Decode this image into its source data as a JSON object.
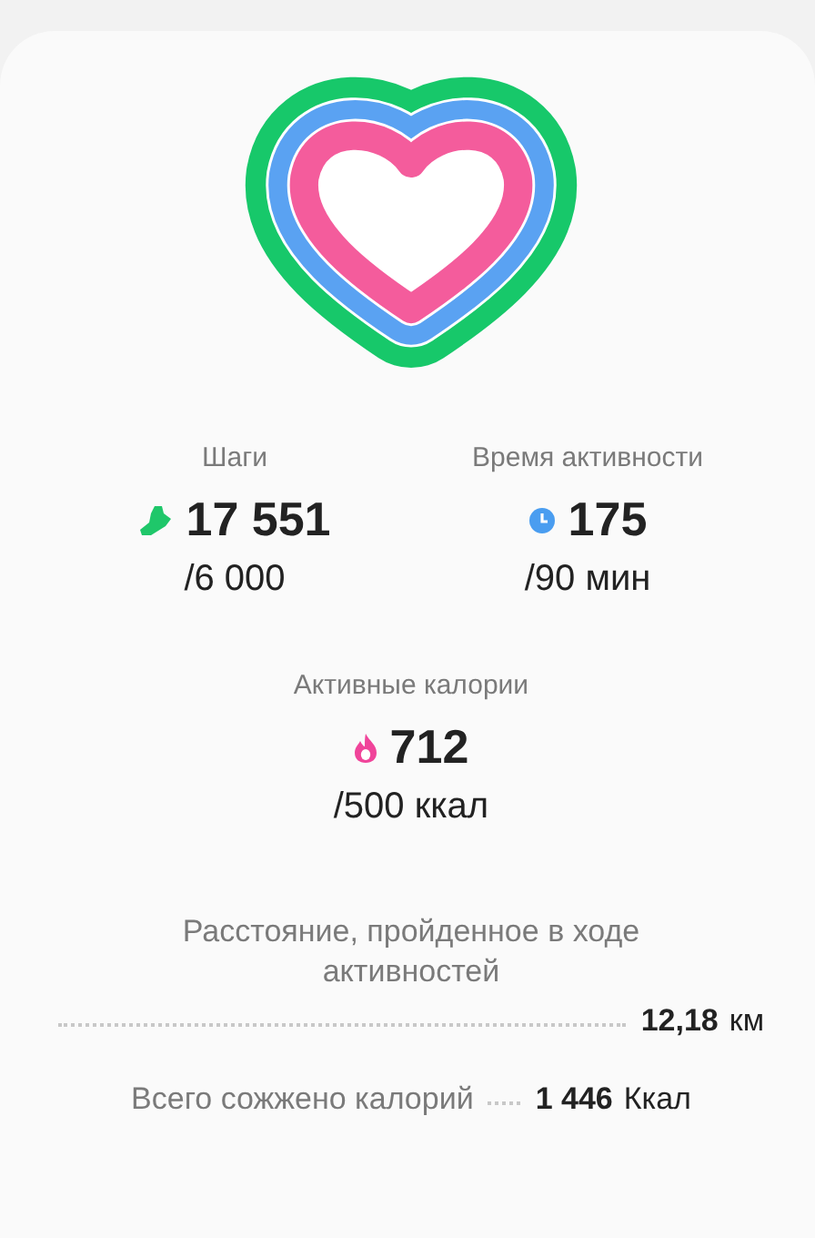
{
  "goals": [
    {
      "kind": "steps",
      "label": "Шаги",
      "value": "17 551",
      "target": "/6 000"
    },
    {
      "kind": "time",
      "label": "Время активности",
      "value": "175",
      "target": "/90 мин"
    },
    {
      "kind": "calories",
      "label": "Активные калории",
      "value": "712",
      "target": "/500 ккал"
    }
  ],
  "summary": [
    {
      "kind": "stacked",
      "label": "Расстояние, пройденное в ходе активностей",
      "value": "12,18",
      "unit": "км"
    },
    {
      "kind": "inline",
      "label": "Всего сожжено калорий",
      "value": "1 446",
      "unit": "Ккал"
    }
  ]
}
